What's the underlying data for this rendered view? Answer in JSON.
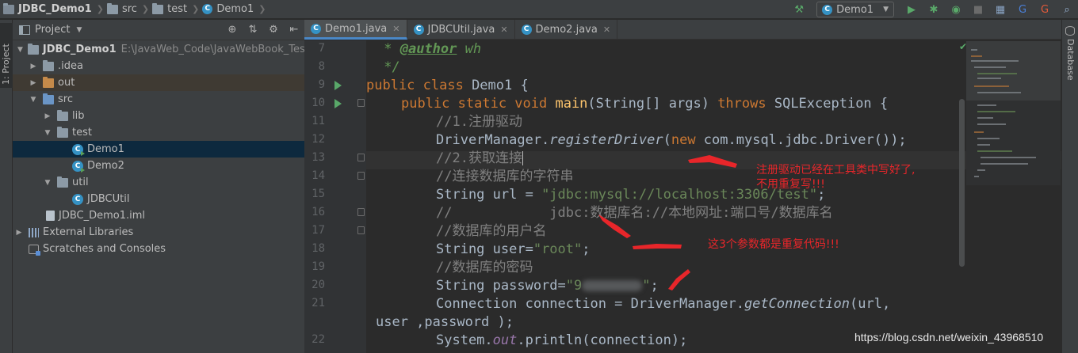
{
  "breadcrumb": {
    "project": "JDBC_Demo1",
    "folder1": "src",
    "folder2": "test",
    "file": "Demo1"
  },
  "toolbar": {
    "run_config": "Demo1"
  },
  "side_tabs": {
    "left": "1: Project",
    "right": "Database"
  },
  "project_panel": {
    "title": "Project",
    "tree": [
      {
        "label": "JDBC_Demo1",
        "path": "E:\\JavaWeb_Code\\JavaWebBook_Test\\Tes"
      },
      {
        "label": ".idea"
      },
      {
        "label": "out"
      },
      {
        "label": "src"
      },
      {
        "label": "lib"
      },
      {
        "label": "test"
      },
      {
        "label": "Demo1"
      },
      {
        "label": "Demo2"
      },
      {
        "label": "util"
      },
      {
        "label": "JDBCUtil"
      },
      {
        "label": "JDBC_Demo1.iml"
      },
      {
        "label": "External Libraries"
      },
      {
        "label": "Scratches and Consoles"
      }
    ]
  },
  "tabs": [
    {
      "label": "Demo1.java"
    },
    {
      "label": "JDBCUtil.java"
    },
    {
      "label": "Demo2.java"
    }
  ],
  "line_numbers": [
    "7",
    "8",
    "9",
    "10",
    "11",
    "12",
    "13",
    "14",
    "15",
    "16",
    "17",
    "18",
    "19",
    "20",
    "21",
    "",
    "22"
  ],
  "code": {
    "l7_tag": "@author",
    "l7_rest": " wh",
    "l9_kw": "public class",
    "l9_rest": " Demo1 {",
    "l10_kw1": "public static void",
    "l10_fn": " main",
    "l10_mid": "(String[] args) ",
    "l10_kw2": "throws",
    "l10_rest": " SQLException {",
    "l11": "//1.注册驱动",
    "l12_a": "DriverManager.",
    "l12_b": "registerDriver",
    "l12_c": "(",
    "l12_kw": "new",
    "l12_d": " com.mysql.jdbc.Driver());",
    "l13": "//2.获取连接",
    "l14": "//连接数据库的字符串",
    "l15_a": "String url = ",
    "l15_s": "\"jdbc:mysql://localhost:3306/test\"",
    "l15_b": ";",
    "l16": "//            jdbc:数据库名://本地网址:端口号/数据库名",
    "l17": "//数据库的用户名",
    "l18_a": "String user=",
    "l18_s": "\"root\"",
    "l18_b": ";",
    "l19": "//数据库的密码",
    "l20_a": "String password=",
    "l20_s1": "\"9",
    "l20_s2": "\"",
    "l20_b": ";",
    "l21_a": "Connection connection = DriverManager.",
    "l21_b": "getConnection",
    "l21_c": "(url,",
    "l21w": "user ,password );",
    "l22_a": "System.",
    "l22_b": "out",
    "l22_c": ".println(connection);"
  },
  "annotations": {
    "a1_line1": "注册驱动已经在工具类中写好了,",
    "a1_line2": "不用重复写!!!",
    "a2": "这3个参数都是重复代码!!!"
  },
  "watermark": "https://blog.csdn.net/weixin_43968510"
}
